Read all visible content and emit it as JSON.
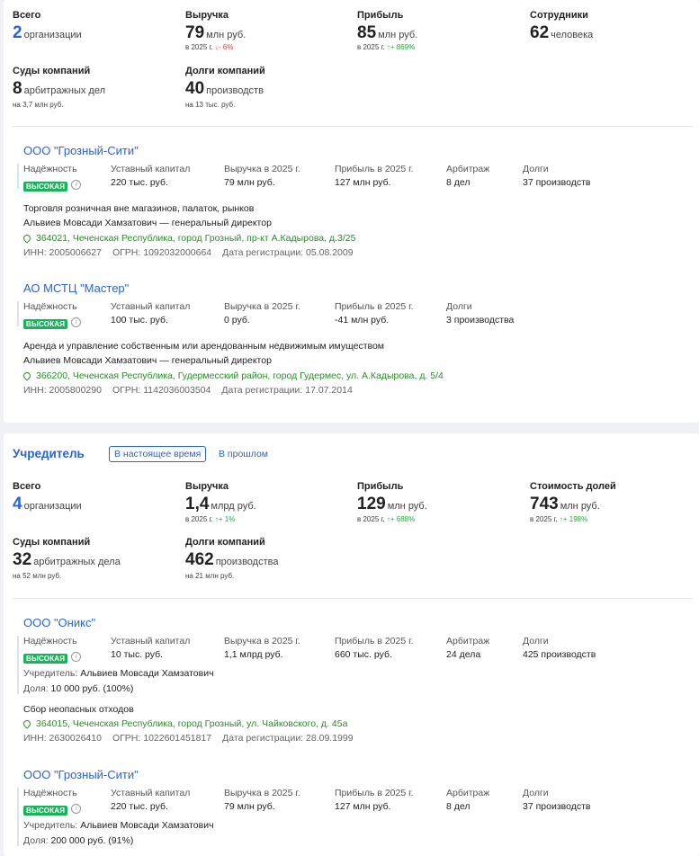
{
  "card1": {
    "stats": {
      "total_label": "Всего",
      "total_value": "2",
      "total_unit": "организации",
      "revenue_label": "Выручка",
      "revenue_value": "79",
      "revenue_unit": "млн руб.",
      "revenue_sub": "в 2025 г.",
      "revenue_change": "- 6%",
      "profit_label": "Прибыль",
      "profit_value": "85",
      "profit_unit": "млн руб.",
      "profit_sub": "в 2025 г.",
      "profit_change": "+ 869%",
      "staff_label": "Сотрудники",
      "staff_value": "62",
      "staff_unit": "человека",
      "courts_label": "Суды компаний",
      "courts_value": "8",
      "courts_unit": "арбитражных дел",
      "courts_sub": "на 3,7 млн руб.",
      "debts_label": "Долги компаний",
      "debts_value": "40",
      "debts_unit": "производств",
      "debts_sub": "на 13 тыс. руб."
    },
    "companies": [
      {
        "name": "ООО \"Грозный-Сити\"",
        "f_rel": "Надёжность",
        "badge": "ВЫСОКАЯ",
        "f_cap": "Уставный капитал",
        "v_cap": "220 тыс. руб.",
        "f_rev": "Выручка в 2025 г.",
        "v_rev": "79 млн руб.",
        "f_prof": "Прибыль в 2025 г.",
        "v_prof": "127 млн руб.",
        "f_arb": "Арбитраж",
        "v_arb": "8 дел",
        "f_debt": "Долги",
        "v_debt": "37 производств",
        "activity": "Торговля розничная вне магазинов, палаток, рынков",
        "director": "Альвиев Мовсади Хамзатович — генеральный директор",
        "address": "364021, Чеченская Республика, город Грозный, пр-кт А.Кадырова, д.3/25",
        "inn": "ИНН: 2005006627",
        "ogrn": "ОГРН: 1092032000664",
        "reg": "Дата регистрации: 05.08.2009"
      },
      {
        "name": "АО МСТЦ \"Мастер\"",
        "f_rel": "Надёжность",
        "badge": "ВЫСОКАЯ",
        "f_cap": "Уставный капитал",
        "v_cap": "100 тыс. руб.",
        "f_rev": "Выручка в 2025 г.",
        "v_rev": "0 руб.",
        "f_prof": "Прибыль в 2025 г.",
        "v_prof": "-41 млн руб.",
        "f_debt": "Долги",
        "v_debt": "3 производства",
        "activity": "Аренда и управление собственным или арендованным недвижимым имуществом",
        "director": "Альвиев Мовсади Хамзатович — генеральный директор",
        "address": "366200, Чеченская Республика, Гудермесский район, город Гудермес, ул. А.Кадырова, д. 5/4",
        "inn": "ИНН: 2005800290",
        "ogrn": "ОГРН: 1142036003504",
        "reg": "Дата регистрации: 17.07.2014"
      }
    ]
  },
  "card2": {
    "title": "Учредитель",
    "tab_now": "В настоящее время",
    "tab_past": "В прошлом",
    "stats": {
      "total_label": "Всего",
      "total_value": "4",
      "total_unit": "организации",
      "revenue_label": "Выручка",
      "revenue_value": "1,4",
      "revenue_unit": "млрд руб.",
      "revenue_sub": "в 2025 г.",
      "revenue_change": "+ 1%",
      "profit_label": "Прибыль",
      "profit_value": "129",
      "profit_unit": "млн руб.",
      "profit_sub": "в 2025 г.",
      "profit_change": "+ 688%",
      "shares_label": "Стоимость долей",
      "shares_value": "743",
      "shares_unit": "млн руб.",
      "shares_sub": "в 2025 г.",
      "shares_change": "+ 198%",
      "courts_label": "Суды компаний",
      "courts_value": "32",
      "courts_unit": "арбитражных дела",
      "courts_sub": "на 52 млн руб.",
      "debts_label": "Долги компаний",
      "debts_value": "462",
      "debts_unit": "производства",
      "debts_sub": "на 21 млн руб."
    },
    "companies": [
      {
        "name": "ООО \"Оникс\"",
        "f_rel": "Надёжность",
        "badge": "ВЫСОКАЯ",
        "f_cap": "Уставный капитал",
        "v_cap": "10 тыс. руб.",
        "f_rev": "Выручка в 2025 г.",
        "v_rev": "1,1 млрд руб.",
        "f_prof": "Прибыль в 2025 г.",
        "v_prof": "660 тыс. руб.",
        "f_arb": "Арбитраж",
        "v_arb": "24 дела",
        "f_debt": "Долги",
        "v_debt": "425 производств",
        "founder_label": "Учредитель:",
        "founder_name": "Альвиев Мовсади Хамзатович",
        "share_label": "Доля:",
        "share_value": "10 000 руб. (100%)",
        "activity": "Сбор неопасных отходов",
        "address": "364015, Чеченская Республика, город Грозный, ул. Чайковского, д. 45а",
        "inn": "ИНН: 2630026410",
        "ogrn": "ОГРН: 1022601451817",
        "reg": "Дата регистрации: 28.09.1999"
      },
      {
        "name": "ООО \"Грозный-Сити\"",
        "f_rel": "Надёжность",
        "badge": "ВЫСОКАЯ",
        "f_cap": "Уставный капитал",
        "v_cap": "220 тыс. руб.",
        "f_rev": "Выручка в 2025 г.",
        "v_rev": "79 млн руб.",
        "f_prof": "Прибыль в 2025 г.",
        "v_prof": "127 млн руб.",
        "f_arb": "Арбитраж",
        "v_arb": "8 дел",
        "f_debt": "Долги",
        "v_debt": "37 производств",
        "founder_label": "Учредитель:",
        "founder_name": "Альвиев Мовсади Хамзатович",
        "share_label": "Доля:",
        "share_value": "200 000 руб. (91%)"
      }
    ]
  },
  "icons": {
    "down": "arrow-down-icon",
    "up": "arrow-up-icon",
    "info": "info-icon",
    "pin": "location-pin-icon"
  },
  "colors": {
    "accent": "#2a64cf",
    "badge": "#1ab35c",
    "address": "#2e8b2e",
    "down": "#e53b3b",
    "up": "#29a745"
  }
}
